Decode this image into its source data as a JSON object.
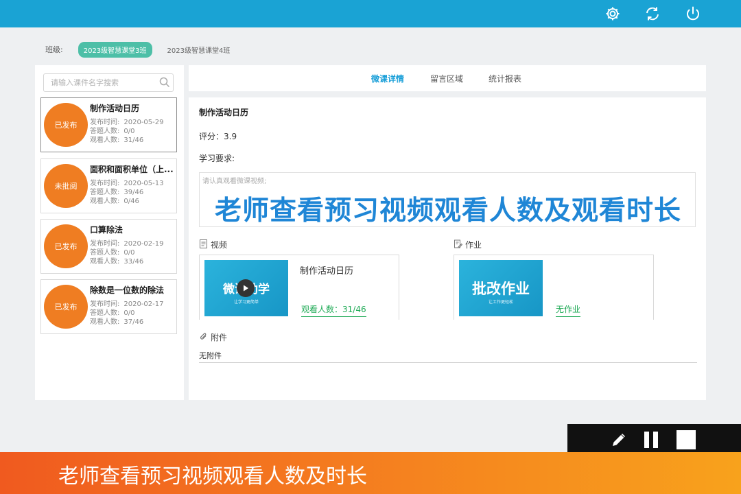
{
  "header": {
    "icons": [
      "gear-icon",
      "refresh-icon",
      "power-icon"
    ]
  },
  "class_selector": {
    "label": "班级:",
    "options": [
      "2023级智慧课堂3班",
      "2023级智慧课堂4班"
    ],
    "selected": "2023级智慧课堂3班"
  },
  "search": {
    "placeholder": "请输入课件名字搜索"
  },
  "meta_labels": {
    "publish": "发布时间:",
    "answered": "答题人数:",
    "viewed": "观看人数:"
  },
  "courses": [
    {
      "badge": "已发布",
      "title": "制作活动日历",
      "publish": "2020-05-29",
      "answered": "0/0",
      "viewed": "31/46"
    },
    {
      "badge": "未批阅",
      "title": "面积和面积单位（上...",
      "publish": "2020-05-13",
      "answered": "39/46",
      "viewed": "0/46"
    },
    {
      "badge": "已发布",
      "title": "口算除法",
      "publish": "2020-02-19",
      "answered": "0/0",
      "viewed": "33/46"
    },
    {
      "badge": "已发布",
      "title": "除数是一位数的除法",
      "publish": "2020-02-17",
      "answered": "0/0",
      "viewed": "37/46"
    }
  ],
  "tabs": [
    "微课详情",
    "留言区域",
    "统计报表"
  ],
  "detail": {
    "title": "制作活动日历",
    "rating": "评分：3.9",
    "requirement_label": "学习要求:",
    "requirement_text": "请认真观看微课视频;",
    "video_label": "视频",
    "video_thumb_title": "微课助学",
    "video_thumb_sub": "让学习更简单",
    "video_title": "制作活动日历",
    "video_views": "观看人数：31/46",
    "homework_label": "作业",
    "homework_thumb_title": "批改作业",
    "homework_thumb_sub": "让工作更轻松",
    "homework_status": "无作业",
    "attachment_label": "附件",
    "attachment_value": "无附件"
  },
  "overlay_caption": "老师查看预习视频观看人数及观看时长",
  "banner_caption": "老师查看预习视频观看人数及时长",
  "colors": {
    "topbar": "#1aa3d4",
    "badge": "#ef7d22",
    "active_tab": "#1a9fd8",
    "link": "#1eaa55",
    "pill": "#4dbfa7"
  }
}
